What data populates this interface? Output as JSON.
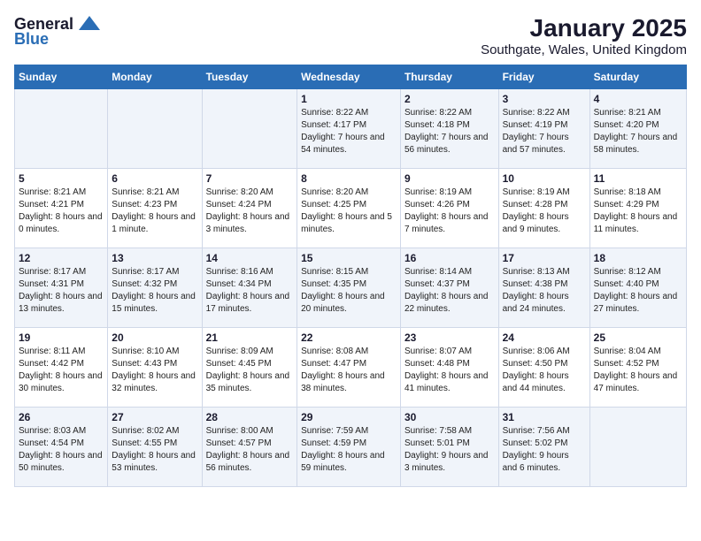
{
  "app": {
    "logo_general": "General",
    "logo_blue": "Blue"
  },
  "title": "January 2025",
  "subtitle": "Southgate, Wales, United Kingdom",
  "weekdays": [
    "Sunday",
    "Monday",
    "Tuesday",
    "Wednesday",
    "Thursday",
    "Friday",
    "Saturday"
  ],
  "weeks": [
    [
      {
        "day": "",
        "sunrise": "",
        "sunset": "",
        "daylight": ""
      },
      {
        "day": "",
        "sunrise": "",
        "sunset": "",
        "daylight": ""
      },
      {
        "day": "",
        "sunrise": "",
        "sunset": "",
        "daylight": ""
      },
      {
        "day": "1",
        "sunrise": "Sunrise: 8:22 AM",
        "sunset": "Sunset: 4:17 PM",
        "daylight": "Daylight: 7 hours and 54 minutes."
      },
      {
        "day": "2",
        "sunrise": "Sunrise: 8:22 AM",
        "sunset": "Sunset: 4:18 PM",
        "daylight": "Daylight: 7 hours and 56 minutes."
      },
      {
        "day": "3",
        "sunrise": "Sunrise: 8:22 AM",
        "sunset": "Sunset: 4:19 PM",
        "daylight": "Daylight: 7 hours and 57 minutes."
      },
      {
        "day": "4",
        "sunrise": "Sunrise: 8:21 AM",
        "sunset": "Sunset: 4:20 PM",
        "daylight": "Daylight: 7 hours and 58 minutes."
      }
    ],
    [
      {
        "day": "5",
        "sunrise": "Sunrise: 8:21 AM",
        "sunset": "Sunset: 4:21 PM",
        "daylight": "Daylight: 8 hours and 0 minutes."
      },
      {
        "day": "6",
        "sunrise": "Sunrise: 8:21 AM",
        "sunset": "Sunset: 4:23 PM",
        "daylight": "Daylight: 8 hours and 1 minute."
      },
      {
        "day": "7",
        "sunrise": "Sunrise: 8:20 AM",
        "sunset": "Sunset: 4:24 PM",
        "daylight": "Daylight: 8 hours and 3 minutes."
      },
      {
        "day": "8",
        "sunrise": "Sunrise: 8:20 AM",
        "sunset": "Sunset: 4:25 PM",
        "daylight": "Daylight: 8 hours and 5 minutes."
      },
      {
        "day": "9",
        "sunrise": "Sunrise: 8:19 AM",
        "sunset": "Sunset: 4:26 PM",
        "daylight": "Daylight: 8 hours and 7 minutes."
      },
      {
        "day": "10",
        "sunrise": "Sunrise: 8:19 AM",
        "sunset": "Sunset: 4:28 PM",
        "daylight": "Daylight: 8 hours and 9 minutes."
      },
      {
        "day": "11",
        "sunrise": "Sunrise: 8:18 AM",
        "sunset": "Sunset: 4:29 PM",
        "daylight": "Daylight: 8 hours and 11 minutes."
      }
    ],
    [
      {
        "day": "12",
        "sunrise": "Sunrise: 8:17 AM",
        "sunset": "Sunset: 4:31 PM",
        "daylight": "Daylight: 8 hours and 13 minutes."
      },
      {
        "day": "13",
        "sunrise": "Sunrise: 8:17 AM",
        "sunset": "Sunset: 4:32 PM",
        "daylight": "Daylight: 8 hours and 15 minutes."
      },
      {
        "day": "14",
        "sunrise": "Sunrise: 8:16 AM",
        "sunset": "Sunset: 4:34 PM",
        "daylight": "Daylight: 8 hours and 17 minutes."
      },
      {
        "day": "15",
        "sunrise": "Sunrise: 8:15 AM",
        "sunset": "Sunset: 4:35 PM",
        "daylight": "Daylight: 8 hours and 20 minutes."
      },
      {
        "day": "16",
        "sunrise": "Sunrise: 8:14 AM",
        "sunset": "Sunset: 4:37 PM",
        "daylight": "Daylight: 8 hours and 22 minutes."
      },
      {
        "day": "17",
        "sunrise": "Sunrise: 8:13 AM",
        "sunset": "Sunset: 4:38 PM",
        "daylight": "Daylight: 8 hours and 24 minutes."
      },
      {
        "day": "18",
        "sunrise": "Sunrise: 8:12 AM",
        "sunset": "Sunset: 4:40 PM",
        "daylight": "Daylight: 8 hours and 27 minutes."
      }
    ],
    [
      {
        "day": "19",
        "sunrise": "Sunrise: 8:11 AM",
        "sunset": "Sunset: 4:42 PM",
        "daylight": "Daylight: 8 hours and 30 minutes."
      },
      {
        "day": "20",
        "sunrise": "Sunrise: 8:10 AM",
        "sunset": "Sunset: 4:43 PM",
        "daylight": "Daylight: 8 hours and 32 minutes."
      },
      {
        "day": "21",
        "sunrise": "Sunrise: 8:09 AM",
        "sunset": "Sunset: 4:45 PM",
        "daylight": "Daylight: 8 hours and 35 minutes."
      },
      {
        "day": "22",
        "sunrise": "Sunrise: 8:08 AM",
        "sunset": "Sunset: 4:47 PM",
        "daylight": "Daylight: 8 hours and 38 minutes."
      },
      {
        "day": "23",
        "sunrise": "Sunrise: 8:07 AM",
        "sunset": "Sunset: 4:48 PM",
        "daylight": "Daylight: 8 hours and 41 minutes."
      },
      {
        "day": "24",
        "sunrise": "Sunrise: 8:06 AM",
        "sunset": "Sunset: 4:50 PM",
        "daylight": "Daylight: 8 hours and 44 minutes."
      },
      {
        "day": "25",
        "sunrise": "Sunrise: 8:04 AM",
        "sunset": "Sunset: 4:52 PM",
        "daylight": "Daylight: 8 hours and 47 minutes."
      }
    ],
    [
      {
        "day": "26",
        "sunrise": "Sunrise: 8:03 AM",
        "sunset": "Sunset: 4:54 PM",
        "daylight": "Daylight: 8 hours and 50 minutes."
      },
      {
        "day": "27",
        "sunrise": "Sunrise: 8:02 AM",
        "sunset": "Sunset: 4:55 PM",
        "daylight": "Daylight: 8 hours and 53 minutes."
      },
      {
        "day": "28",
        "sunrise": "Sunrise: 8:00 AM",
        "sunset": "Sunset: 4:57 PM",
        "daylight": "Daylight: 8 hours and 56 minutes."
      },
      {
        "day": "29",
        "sunrise": "Sunrise: 7:59 AM",
        "sunset": "Sunset: 4:59 PM",
        "daylight": "Daylight: 8 hours and 59 minutes."
      },
      {
        "day": "30",
        "sunrise": "Sunrise: 7:58 AM",
        "sunset": "Sunset: 5:01 PM",
        "daylight": "Daylight: 9 hours and 3 minutes."
      },
      {
        "day": "31",
        "sunrise": "Sunrise: 7:56 AM",
        "sunset": "Sunset: 5:02 PM",
        "daylight": "Daylight: 9 hours and 6 minutes."
      },
      {
        "day": "",
        "sunrise": "",
        "sunset": "",
        "daylight": ""
      }
    ]
  ]
}
